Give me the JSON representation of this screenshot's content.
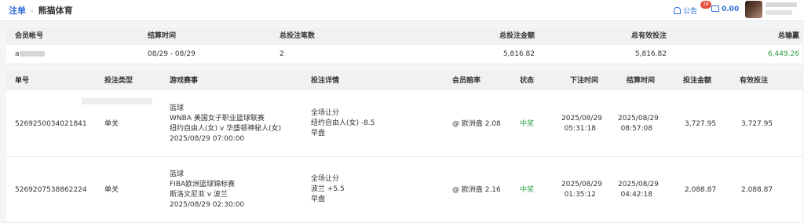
{
  "header": {
    "breadcrumb_root": "注单",
    "breadcrumb_sep": "›",
    "breadcrumb_current": "熊猫体育",
    "notice_label": "公告",
    "notice_badge": "38",
    "balance": "0.00"
  },
  "summary": {
    "columns": [
      "会员帐号",
      "结算时间",
      "总投注笔数",
      "总投注金额",
      "总有效投注",
      "总输赢"
    ],
    "row": {
      "account": "a",
      "settle_range": "08/29 - 08/29",
      "bet_count": "2",
      "total_bet": "5,816.82",
      "total_valid": "5,816.82",
      "total_win": "6,449.26"
    }
  },
  "detail": {
    "columns": [
      "单号",
      "投注类型",
      "游戏赛事",
      "投注详情",
      "会员赔率",
      "状态",
      "下注时间",
      "结算时间",
      "投注金额",
      "有效投注"
    ],
    "rows": [
      {
        "order_no": "5269250034021841",
        "bet_type": "单关",
        "event": [
          "篮球",
          "WNBA 美国女子职业篮球联赛",
          "纽约自由人(女) v 华盛顿神秘人(女)",
          "2025/08/29 07:00:00"
        ],
        "bet_detail": [
          "全场让分",
          "纽约自由人(女) -8.5",
          "早盘"
        ],
        "odds": "@ 欧洲盘 2.08",
        "status": "中奖",
        "bet_time": [
          "2025/08/29",
          "05:31:18"
        ],
        "settle_time": [
          "2025/08/29",
          "08:57:08"
        ],
        "amount": "3,727.95",
        "valid": "3,727.95"
      },
      {
        "order_no": "5269207538862224",
        "bet_type": "单关",
        "event": [
          "篮球",
          "FIBA欧洲篮球锦标赛",
          "斯洛文尼亚 v 波兰",
          "2025/08/29 02:30:00"
        ],
        "bet_detail": [
          "全场让分",
          "波兰 +5.5",
          "早盘"
        ],
        "odds": "@ 欧洲盘 2.16",
        "status": "中奖",
        "bet_time": [
          "2025/08/29",
          "01:35:12"
        ],
        "settle_time": [
          "2025/08/29",
          "04:42:18"
        ],
        "amount": "2,088.87",
        "valid": "2,088.87"
      }
    ]
  },
  "colors": {
    "accent": "#2f6ed8",
    "win_green": "#2e9d3e",
    "badge_red": "#e74c3c"
  }
}
